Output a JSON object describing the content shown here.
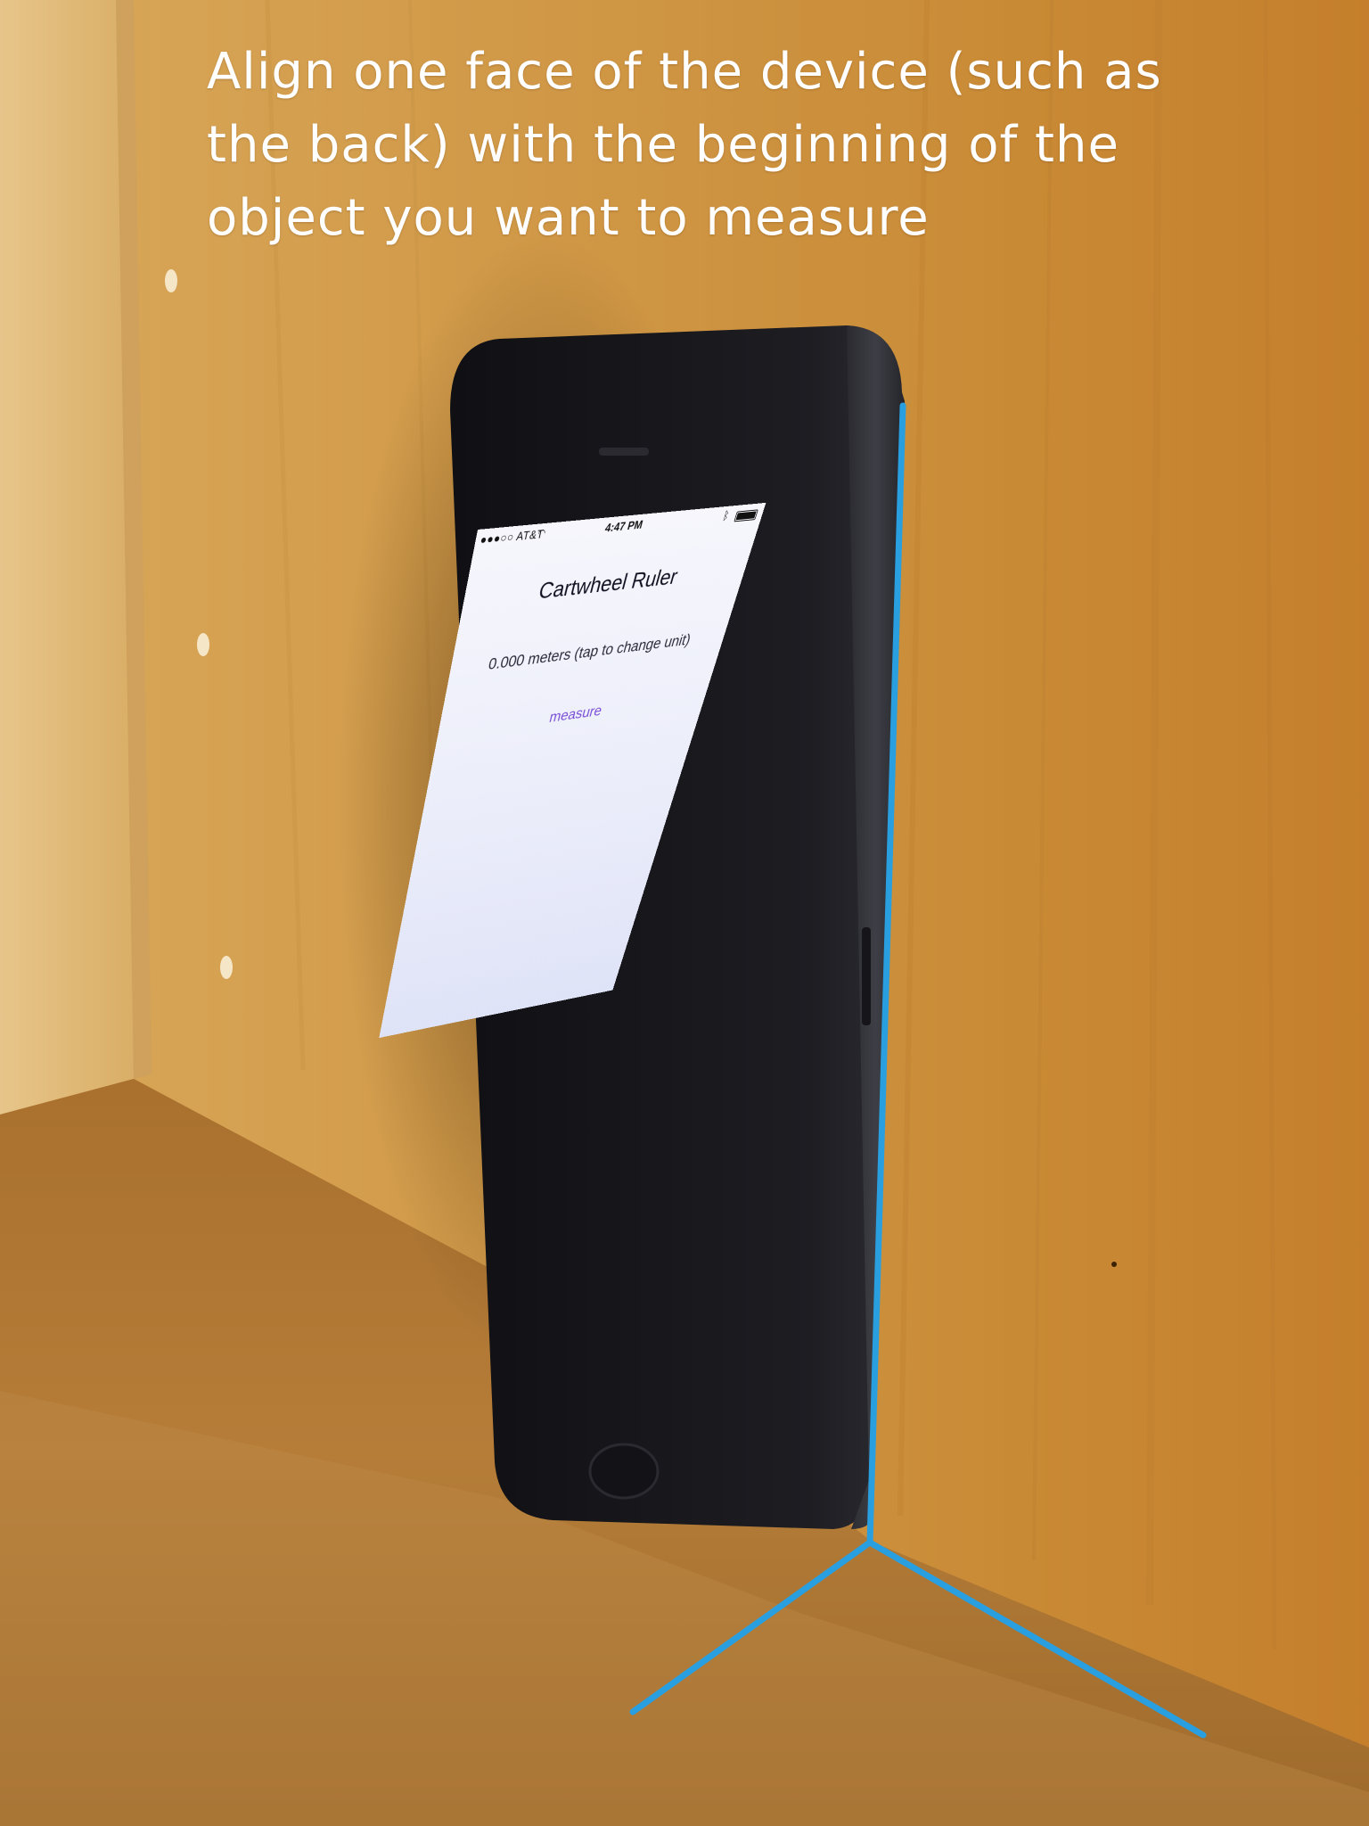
{
  "caption": {
    "line1": "Align one face of the device (such as",
    "line2": "the back) with the beginning of the",
    "line3": "object you want to measure"
  },
  "phone": {
    "status_bar": {
      "carrier": "●●●○○ AT&T",
      "wifi_icon": "wifi-icon",
      "time": "4:47 PM",
      "bluetooth_icon": "bluetooth-icon",
      "battery_icon": "battery-icon"
    },
    "app": {
      "title": "Cartwheel Ruler",
      "reading": "0.000 meters (tap to change unit)",
      "measure_label": "measure"
    }
  },
  "colors": {
    "guide_line": "#2a9fe0",
    "wood": "#c48a38",
    "app_link": "#7b4fd6"
  }
}
